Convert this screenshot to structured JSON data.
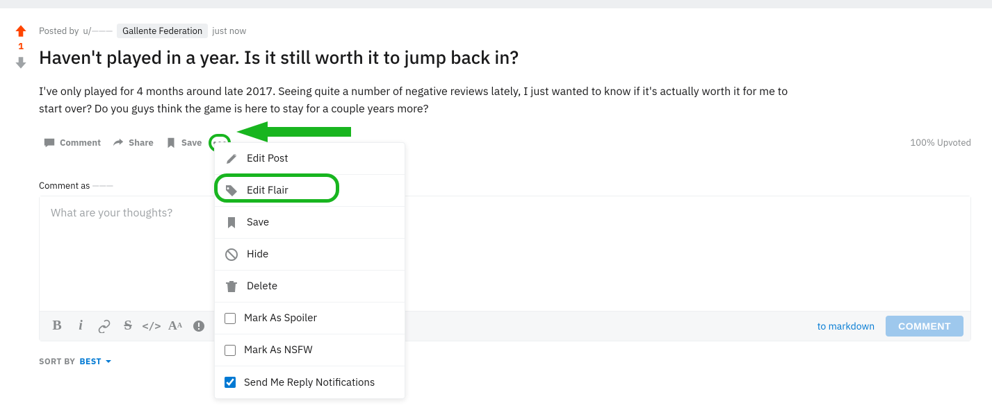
{
  "vote": {
    "count": "1"
  },
  "meta": {
    "posted_by": "Posted by",
    "author_prefix": "u/",
    "author": "———",
    "flair": "Gallente Federation",
    "time": "just now"
  },
  "title": "Haven't played in a year. Is it still worth it to jump back in?",
  "body": "I've only played for 4 months around late 2017. Seeing quite a number of negative reviews lately, I just wanted to know if it's actually worth it for me to start over? Do you guys think the game is here to stay for a couple years more?",
  "actions": {
    "comment": "Comment",
    "share": "Share",
    "save": "Save"
  },
  "upvoted": "100% Upvoted",
  "comment_as": {
    "label": "Comment as",
    "user": "———"
  },
  "comment_box": {
    "placeholder": "What are your thoughts?",
    "markdown_link": "to markdown",
    "submit": "COMMENT"
  },
  "sort": {
    "label": "SORT BY",
    "value": "BEST"
  },
  "dropdown": {
    "edit_post": "Edit Post",
    "edit_flair": "Edit Flair",
    "save": "Save",
    "hide": "Hide",
    "delete": "Delete",
    "spoiler": "Mark As Spoiler",
    "nsfw": "Mark As NSFW",
    "notifications": "Send Me Reply Notifications"
  }
}
